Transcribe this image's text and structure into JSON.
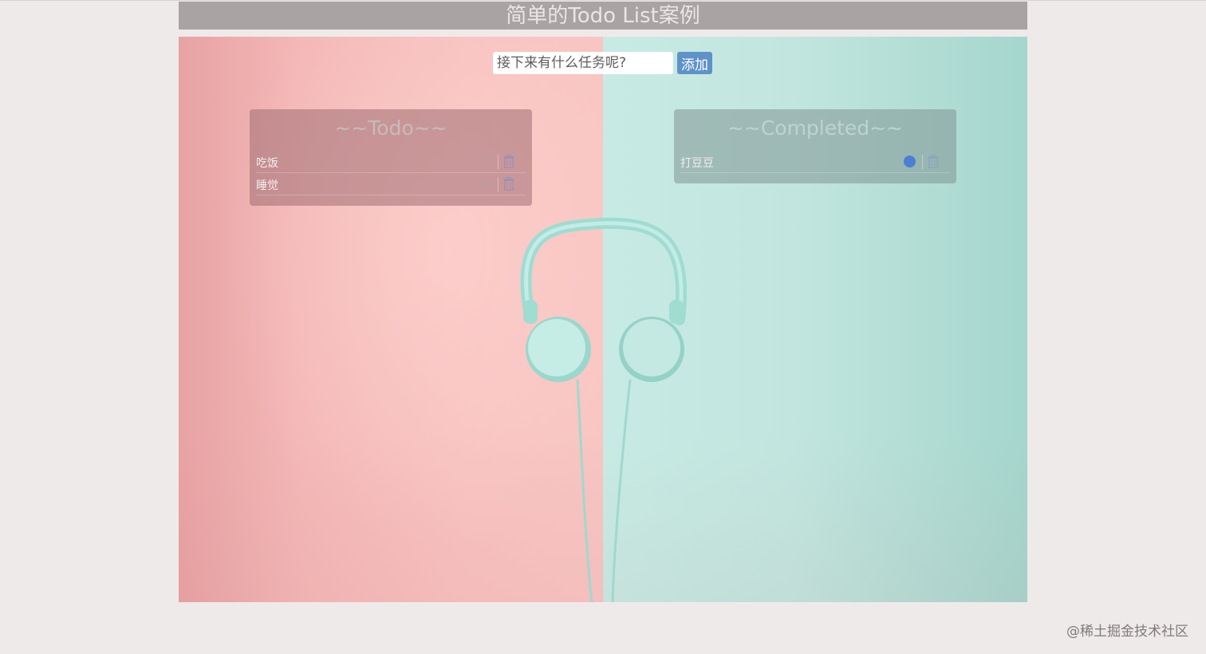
{
  "header": {
    "title": "简单的Todo List案例"
  },
  "add_form": {
    "placeholder": "接下来有什么任务呢?",
    "button_label": "添加"
  },
  "todo_panel": {
    "title": "~~Todo~~",
    "items": [
      {
        "text": "吃饭",
        "done": false
      },
      {
        "text": "睡觉",
        "done": false
      }
    ]
  },
  "completed_panel": {
    "title": "~~Completed~~",
    "items": [
      {
        "text": "打豆豆",
        "done": true
      }
    ]
  },
  "icons": {
    "check": "circle-check-icon",
    "delete": "trash-icon"
  },
  "colors": {
    "header_bg": "#a9a3a3",
    "accent": "#5f92c9",
    "checked": "#4a7fd1",
    "page_bg": "#efeaea"
  },
  "watermark": "@稀土掘金技术社区"
}
